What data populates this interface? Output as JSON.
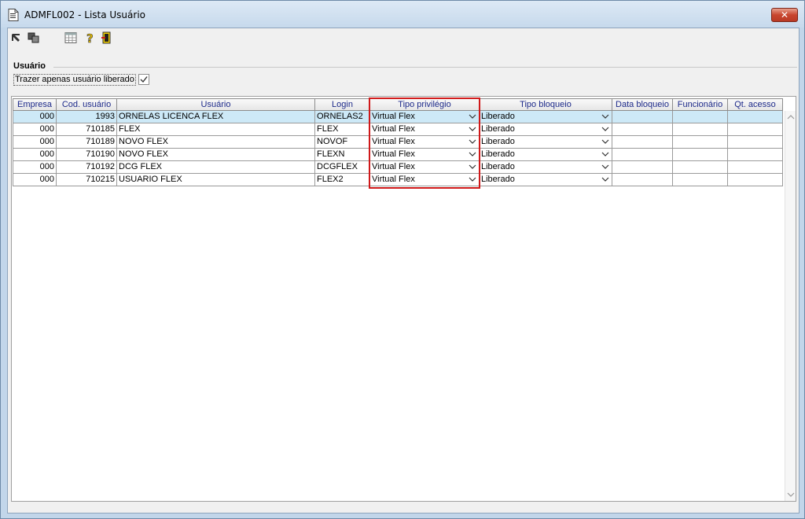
{
  "window": {
    "title": "ADMFL002 - Lista Usuário",
    "close_label": "✕"
  },
  "toolbar": {
    "buttons": [
      "first-record-icon",
      "copy-icon",
      "calendar-grid-icon",
      "help-icon",
      "exit-door-icon"
    ]
  },
  "filter_group": {
    "legend": "Usuário",
    "checkbox_label": "Trazer apenas usuário liberado",
    "checked": true
  },
  "grid": {
    "columns": [
      "Empresa",
      "Cod. usuário",
      "Usuário",
      "Login",
      "Tipo privilégio",
      "Tipo bloqueio",
      "Data bloqueio",
      "Funcionário",
      "Qt. acesso"
    ],
    "rows": [
      {
        "empresa": "000",
        "cod": "1993",
        "usuario": "ORNELAS LICENCA FLEX",
        "login": "ORNELAS2",
        "privilegio": "Virtual Flex",
        "bloqueio": "Liberado",
        "data": "",
        "funcionario": "",
        "qt": ""
      },
      {
        "empresa": "000",
        "cod": "710185",
        "usuario": "FLEX",
        "login": "FLEX",
        "privilegio": "Virtual Flex",
        "bloqueio": "Liberado",
        "data": "",
        "funcionario": "",
        "qt": ""
      },
      {
        "empresa": "000",
        "cod": "710189",
        "usuario": "NOVO FLEX",
        "login": "NOVOF",
        "privilegio": "Virtual Flex",
        "bloqueio": "Liberado",
        "data": "",
        "funcionario": "",
        "qt": ""
      },
      {
        "empresa": "000",
        "cod": "710190",
        "usuario": "NOVO FLEX",
        "login": "FLEXN",
        "privilegio": "Virtual Flex",
        "bloqueio": "Liberado",
        "data": "",
        "funcionario": "",
        "qt": ""
      },
      {
        "empresa": "000",
        "cod": "710192",
        "usuario": "DCG FLEX",
        "login": "DCGFLEX",
        "privilegio": "Virtual Flex",
        "bloqueio": "Liberado",
        "data": "",
        "funcionario": "",
        "qt": ""
      },
      {
        "empresa": "000",
        "cod": "710215",
        "usuario": "USUARIO FLEX",
        "login": "FLEX2",
        "privilegio": "Virtual Flex",
        "bloqueio": "Liberado",
        "data": "",
        "funcionario": "",
        "qt": ""
      }
    ]
  },
  "colors": {
    "selected_row": "#cde9f7",
    "header_text": "#1d2a8a",
    "highlight_border": "#d0191a"
  }
}
